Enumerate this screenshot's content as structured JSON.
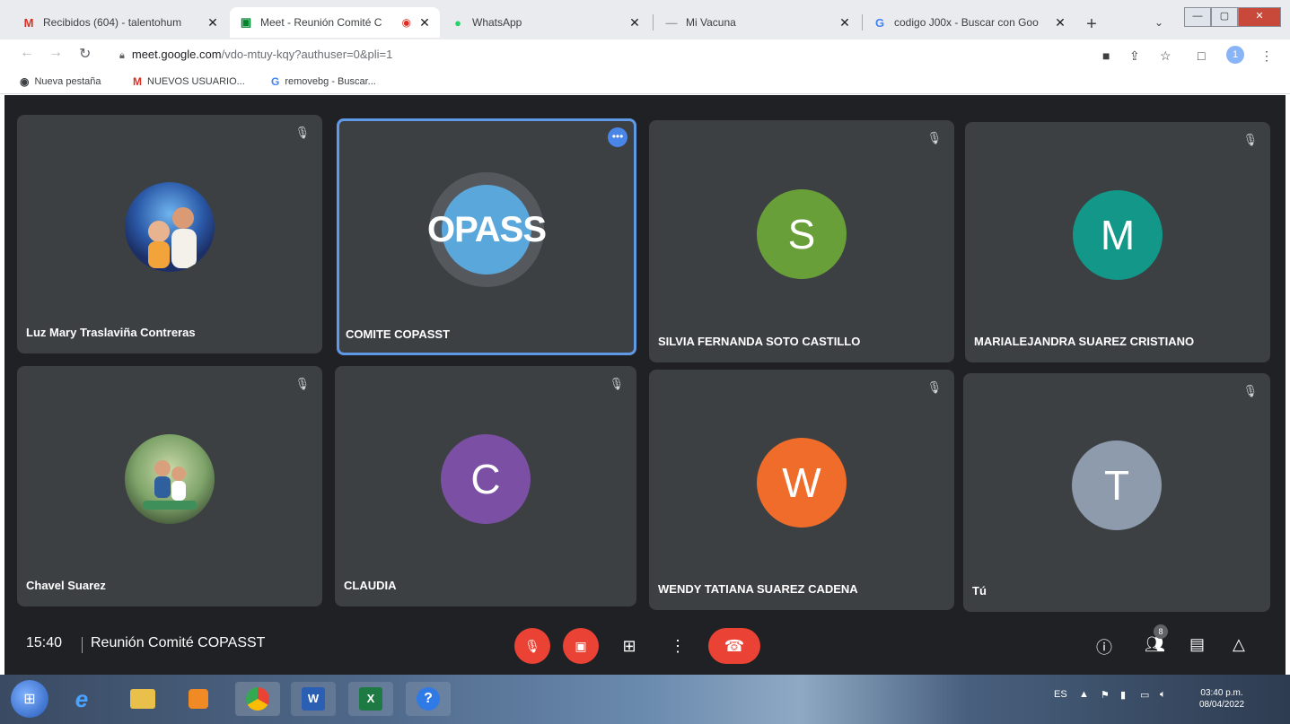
{
  "browser": {
    "tabs": [
      {
        "title": "Recibidos (604) - talentohum",
        "favicon": "M",
        "favicon_color": "#d93025"
      },
      {
        "title": "Meet - Reunión Comité C",
        "favicon": "M",
        "favicon_color": "#00832d",
        "active": true
      },
      {
        "title": "WhatsApp",
        "favicon": "W",
        "favicon_color": "#25d366"
      },
      {
        "title": "Mi Vacuna",
        "favicon": "—",
        "favicon_color": "#9aa0a6"
      },
      {
        "title": "codigo J00x - Buscar con Goo",
        "favicon": "G",
        "favicon_color": "#4285f4"
      }
    ],
    "address": {
      "domain": "meet.google.com",
      "path": "/vdo-mtuy-kqy?authuser=0&pli=1"
    },
    "bookmarks": [
      {
        "label": "Nueva pestaña",
        "icon": "globe-icon"
      },
      {
        "label": "NUEVOS USUARIO...",
        "icon": "gmail-icon"
      },
      {
        "label": "removebg - Buscar...",
        "icon": "google-icon"
      }
    ],
    "profile_initial": "1"
  },
  "meet": {
    "participants": [
      {
        "name": "Luz Mary Traslaviña Contreras",
        "avatar_type": "photo",
        "muted": true
      },
      {
        "name": "COMITE COPASST",
        "avatar_type": "logo",
        "avatar_text": "OPASS",
        "avatar_color": "#5aa7dc",
        "speaking": true
      },
      {
        "name": "SILVIA FERNANDA SOTO CASTILLO",
        "avatar_type": "letter",
        "avatar_text": "S",
        "avatar_color": "#689f38",
        "muted": true
      },
      {
        "name": "MARIALEJANDRA SUAREZ CRISTIANO",
        "avatar_type": "letter",
        "avatar_text": "M",
        "avatar_color": "#129788",
        "muted": true
      },
      {
        "name": "Chavel Suarez",
        "avatar_type": "photo",
        "muted": true
      },
      {
        "name": "CLAUDIA",
        "avatar_type": "letter",
        "avatar_text": "C",
        "avatar_color": "#7b4fa3",
        "muted": true
      },
      {
        "name": "WENDY TATIANA SUAREZ CADENA",
        "avatar_type": "letter",
        "avatar_text": "W",
        "avatar_color": "#ef6c2a",
        "muted": true
      },
      {
        "name": "Tú",
        "avatar_type": "letter",
        "avatar_text": "T",
        "avatar_color": "#8d9bad",
        "muted": true
      }
    ],
    "bottom": {
      "time": "15:40",
      "meeting_name": "Reunión Comité COPASST",
      "participant_count": "8"
    }
  },
  "taskbar": {
    "language": "ES",
    "time": "03:40 p.m.",
    "date": "08/04/2022",
    "apps": [
      "windows-start",
      "internet-explorer",
      "file-explorer",
      "media-player",
      "chrome",
      "word",
      "excel",
      "help"
    ]
  }
}
